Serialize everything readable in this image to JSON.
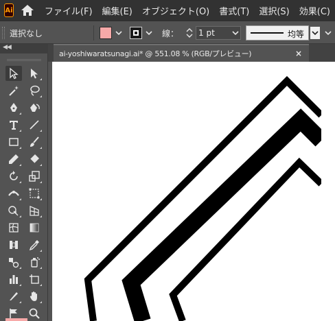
{
  "app": {
    "logo_text": "Ai",
    "menu": [
      "ファイル(F)",
      "編集(E)",
      "オブジェクト(O)",
      "書式(T)",
      "選択(S)",
      "効果(C)"
    ]
  },
  "control": {
    "selection_label": "選択なし",
    "fill_color": "#f7a9a8",
    "stroke_label": "線：",
    "stroke_weight": "1 pt",
    "profile_label": "均等"
  },
  "document": {
    "tab_title": "ai-yoshiwaratsunagi.ai* @ 551.08 % (RGB/プレビュー)",
    "close_glyph": "×"
  },
  "tools": [
    {
      "name": "selection-tool-icon",
      "active": true
    },
    {
      "name": "direct-selection-tool-icon"
    },
    {
      "name": "magic-wand-tool-icon"
    },
    {
      "name": "lasso-tool-icon"
    },
    {
      "name": "pen-tool-icon"
    },
    {
      "name": "curvature-tool-icon"
    },
    {
      "name": "type-tool-icon"
    },
    {
      "name": "line-segment-tool-icon"
    },
    {
      "name": "rectangle-tool-icon"
    },
    {
      "name": "paintbrush-tool-icon"
    },
    {
      "name": "pencil-tool-icon"
    },
    {
      "name": "eraser-tool-icon"
    },
    {
      "name": "rotate-tool-icon"
    },
    {
      "name": "scale-tool-icon"
    },
    {
      "name": "width-tool-icon"
    },
    {
      "name": "free-transform-tool-icon"
    },
    {
      "name": "shape-builder-tool-icon"
    },
    {
      "name": "perspective-grid-tool-icon"
    },
    {
      "name": "mesh-tool-icon"
    },
    {
      "name": "gradient-tool-icon"
    },
    {
      "name": "eyedropper-tool-icon"
    },
    {
      "name": "measure-tool-icon"
    },
    {
      "name": "blend-tool-icon"
    },
    {
      "name": "symbol-sprayer-tool-icon"
    },
    {
      "name": "column-graph-tool-icon"
    },
    {
      "name": "artboard-tool-icon"
    },
    {
      "name": "slice-tool-icon"
    },
    {
      "name": "hand-tool-icon"
    },
    {
      "name": "flag-tool-icon"
    },
    {
      "name": "zoom-tool-icon"
    }
  ],
  "colors": {
    "menubar_bg": "#323232",
    "panel_bg": "#535353",
    "canvas_bg": "#ffffff",
    "art_stroke": "#000000",
    "logo_accent": "#ff9a00"
  }
}
